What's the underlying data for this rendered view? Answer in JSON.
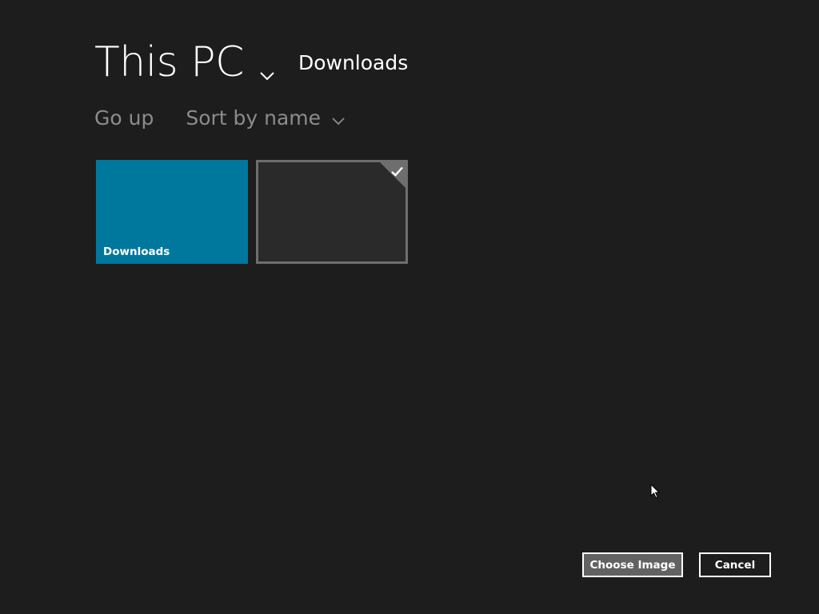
{
  "header": {
    "location_title": "This PC",
    "location_chevron_icon": "chevron-down-icon",
    "current_folder": "Downloads"
  },
  "toolbar": {
    "go_up_label": "Go up",
    "sort_label": "Sort by name",
    "sort_chevron_icon": "chevron-down-icon"
  },
  "tiles": [
    {
      "label": "Downloads",
      "type": "folder",
      "color": "#00779c",
      "selected": false
    },
    {
      "label": "",
      "type": "file",
      "color": "#2a2a2a",
      "selected": true,
      "selection_icon": "checkmark-icon"
    }
  ],
  "actions": {
    "primary_label": "Choose Image",
    "secondary_label": "Cancel"
  },
  "theme": {
    "background": "#1d1d1d",
    "accent": "#00779c",
    "muted_text": "#8c8c8c",
    "selection_border": "#6e6e6e",
    "primary_button": "#626262"
  }
}
